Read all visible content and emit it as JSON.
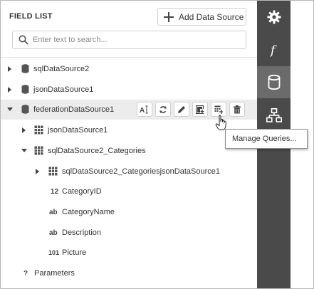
{
  "panel": {
    "title": "FIELD LIST",
    "add_data_source_label": "Add Data Source",
    "search_placeholder": "Enter text to search..."
  },
  "tree": {
    "row1": "sqlDataSource2",
    "row2": "jsonDataSource1",
    "row3": "federationDataSource1",
    "row4": "jsonDataSource1",
    "row5": "sqlDataSource2_Categories",
    "row6": "sqlDataSource2_CategoriesjsonDataSource1",
    "row7": "CategoryID",
    "row8": "CategoryName",
    "row9": "Description",
    "row10": "Picture",
    "row11": "Parameters"
  },
  "type_icons": {
    "number": "12",
    "string": "ab",
    "binary": "101",
    "unknown": "?"
  },
  "tooltip": "Manage Queries...",
  "sidebar_icons": [
    "gear-icon",
    "function-icon",
    "database-icon",
    "hierarchy-icon"
  ],
  "colors": {
    "sidebar": "#4a4a4a",
    "sidebar_active": "#6b6b6b",
    "highlight_row": "#ececec"
  }
}
